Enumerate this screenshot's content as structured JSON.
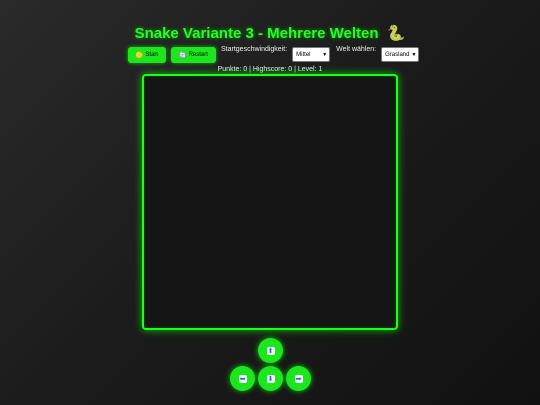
{
  "title": "Snake Variante 3 - Mehrere Welten",
  "title_emoji": "🐍",
  "controls": {
    "start_label": "Start",
    "start_icon": "🟡",
    "restart_label": "Restart",
    "restart_icon": "🔄",
    "speed_label": "Startgeschwindigkeit:",
    "speed_value": "Mittel",
    "world_label": "Welt wählen:",
    "world_value": "Grasland"
  },
  "score_text": "Punkte: 0 | Highscore: 0 | Level: 1",
  "dpad": {
    "up": "⬆",
    "left": "⬅",
    "down": "⬇",
    "right": "➡"
  },
  "colors": {
    "accent": "#1ee61e",
    "background": "#1a1a1a",
    "board": "#141414"
  }
}
